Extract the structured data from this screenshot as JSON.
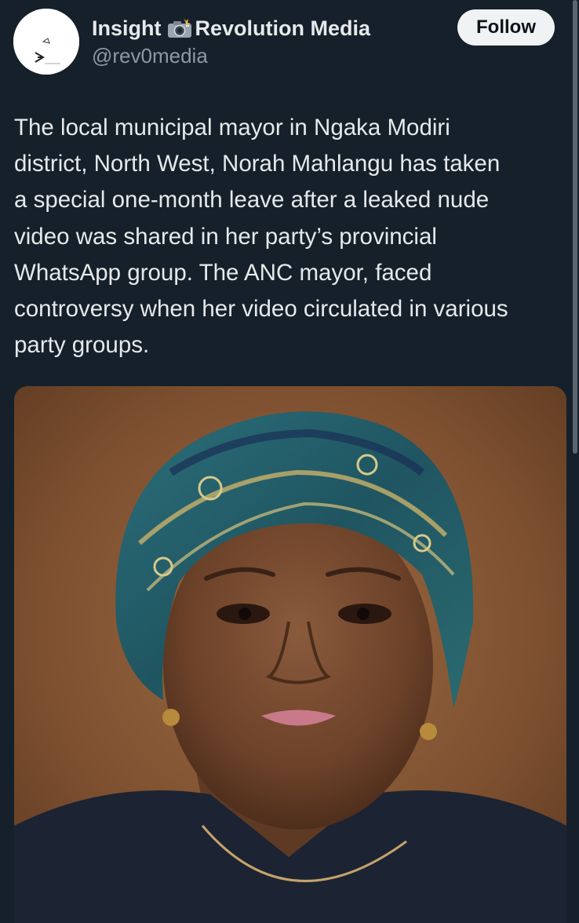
{
  "author": {
    "name_part1": "Insight",
    "name_emoji": "camera-with-flash-icon",
    "name_part2": "Revolution Media",
    "handle": "@rev0media"
  },
  "follow_button": {
    "label": "Follow"
  },
  "tweet": {
    "text_lines": [
      "The local municipal mayor in Ngaka Modiri",
      "district, North West, Norah Mahlangu has taken",
      "a special one-month leave after a leaked nude",
      "video was shared in her party’s provincial",
      "WhatsApp group. The ANC mayor, faced",
      "controversy when her video circulated in various",
      "party groups."
    ]
  },
  "media": {
    "kind": "photo",
    "subject": "portrait-photo"
  },
  "colors": {
    "background": "#15202b",
    "text_primary": "#e7e9ea",
    "text_secondary": "#8b98a5",
    "button_bg": "#eff3f4",
    "button_text": "#0f1419"
  }
}
